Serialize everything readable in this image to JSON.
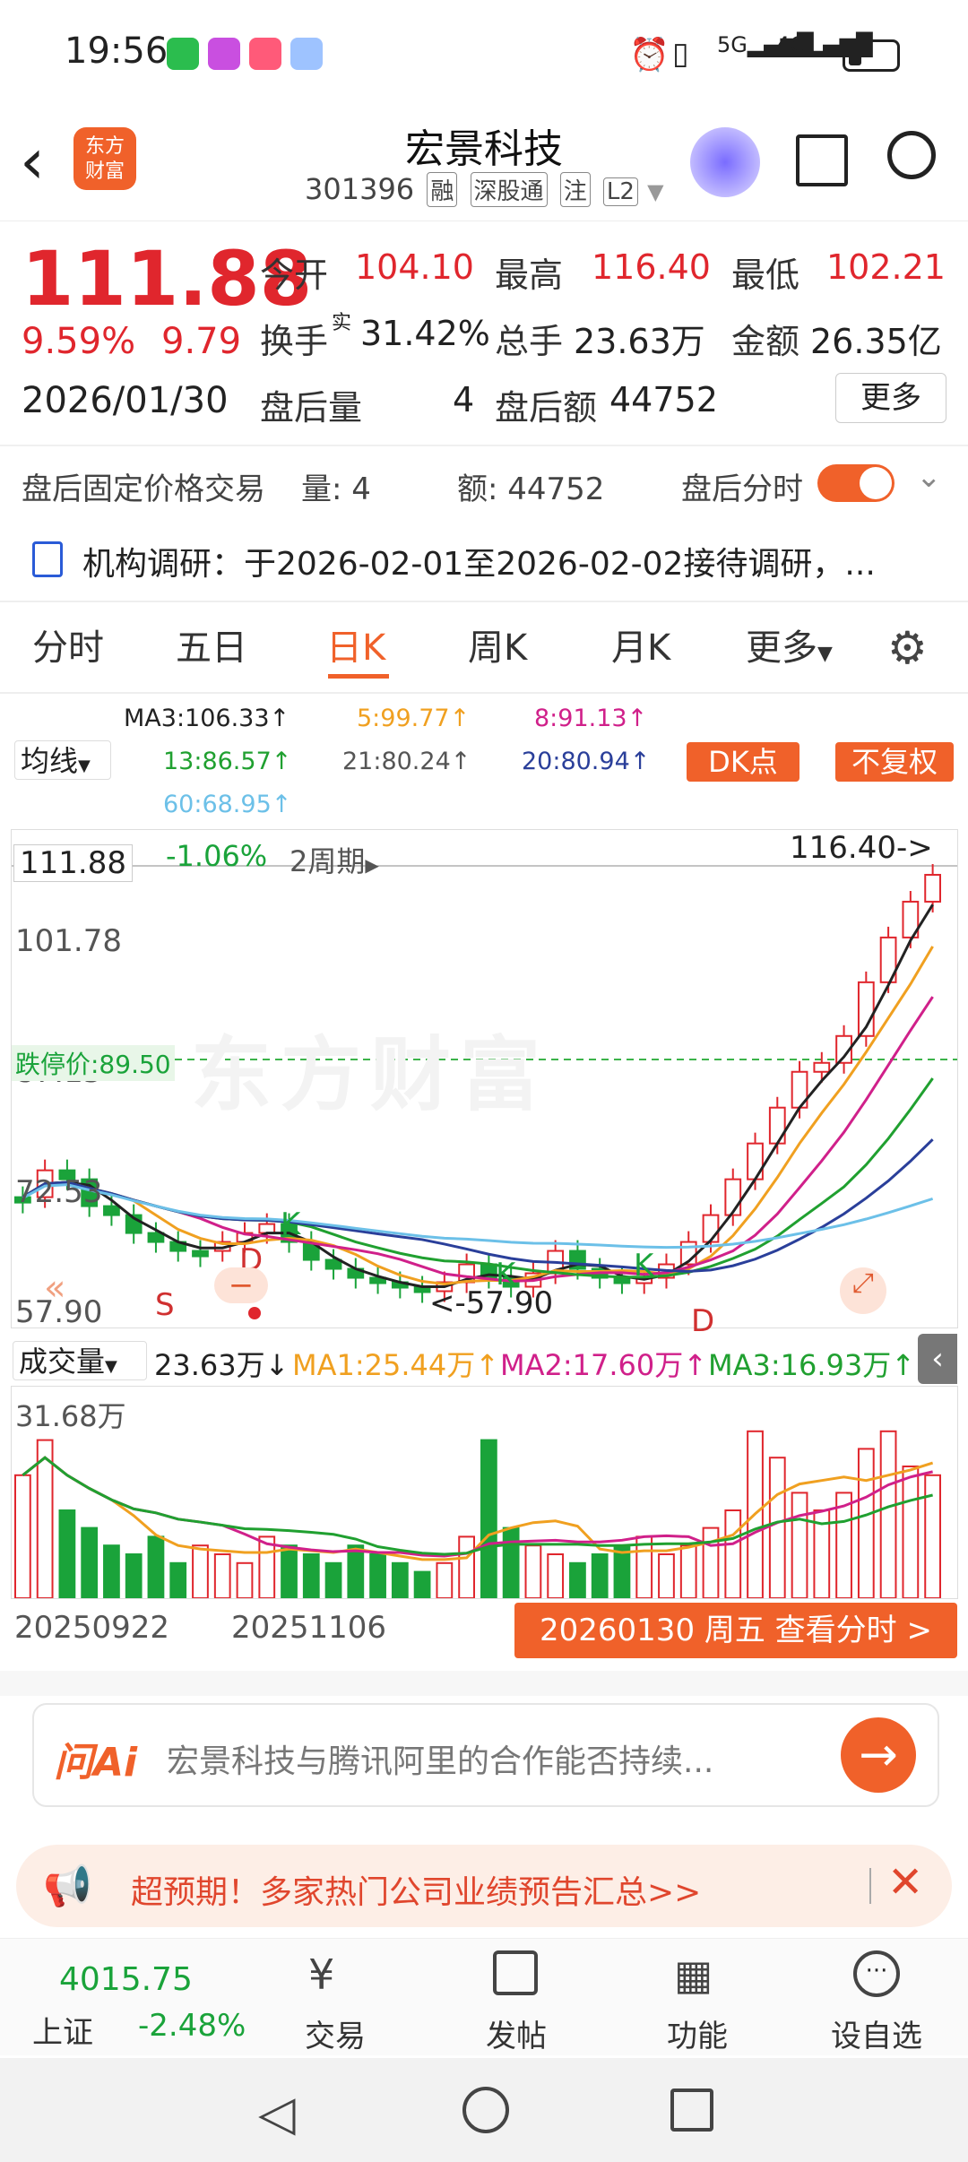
{
  "status_bar": {
    "time": "19:56",
    "icons": [
      "wechat-icon",
      "video-icon",
      "music-icon",
      "chat-bot-icon",
      "alarm-icon",
      "vibrate-icon",
      "signal-5g-icon",
      "signal-4g-icon",
      "battery-icon"
    ]
  },
  "header": {
    "title": "宏景科技",
    "code": "301396",
    "tags": [
      "融",
      "深股通",
      "注",
      "L2"
    ],
    "logo_text": "东方\n财富"
  },
  "quote": {
    "price": "111.88",
    "change_pct": "9.59%",
    "change": "9.79",
    "date": "2026/01/30",
    "open_label": "今开",
    "open": "104.10",
    "high_label": "最高",
    "high": "116.40",
    "low_label": "最低",
    "low": "102.21",
    "turnover_label": "换手",
    "turnover_sup": "实",
    "turnover": "31.42%",
    "volume_label": "总手",
    "volume": "23.63万",
    "amount_label": "金额",
    "amount": "26.35亿",
    "after_vol_label": "盘后量",
    "after_vol": "4",
    "after_amt_label": "盘后额",
    "after_amt": "44752",
    "more_button": "更多"
  },
  "after_hours": {
    "label": "盘后固定价格交易",
    "qty": "量: 4",
    "amt": "额: 44752",
    "toggle_label": "盘后分时"
  },
  "news": {
    "text": "机构调研：于2026-02-01至2026-02-02接待调研，..."
  },
  "tabs": [
    "分时",
    "五日",
    "日K",
    "周K",
    "月K",
    "更多"
  ],
  "active_tab": "日K",
  "ma_legend": {
    "selector": "均线",
    "ma3": "MA3:106.33↑",
    "ma5": "5:99.77↑",
    "ma8": "8:91.13↑",
    "ma13": "13:86.57↑",
    "ma21": "21:80.24↑",
    "ma20": "20:80.94↑",
    "ma60": "60:68.95↑",
    "dk_button": "DK点",
    "fq_button": "不复权"
  },
  "chart": {
    "current_price_tag": "111.88",
    "interval_pct": "-1.06%",
    "period": "2周期",
    "high_marker": "116.40->",
    "low_marker": "<-57.90",
    "limit_down": "跌停价:89.50",
    "y_labels": [
      "101.78",
      "87.15",
      "72.53",
      "57.90"
    ],
    "markers": [
      "S",
      "D",
      "K",
      "K",
      "K",
      "D"
    ]
  },
  "volume": {
    "selector": "成交量",
    "current": "23.63万↓",
    "ma1": "MA1:25.44万↑",
    "ma2": "MA2:17.60万↑",
    "ma3": "MA3:16.93万↑",
    "max_label": "31.68万",
    "date_start": "20250922",
    "date_mid": "20251106",
    "detail_button": "20260130 周五 查看分时 >"
  },
  "ai_bar": {
    "brand": "问Ai",
    "placeholder": "宏景科技与腾讯阿里的合作能否持续..."
  },
  "promo": {
    "text": "超预期！多家热门公司业绩预告汇总>>"
  },
  "bottom_nav": {
    "index_value": "4015.75",
    "index_name": "上证",
    "index_change": "-2.48%",
    "items": [
      "交易",
      "发帖",
      "功能",
      "设自选"
    ]
  },
  "colors": {
    "up": "#e0262d",
    "down": "#1aa33a",
    "accent": "#f0612a",
    "ma3": "#222222",
    "ma5": "#f0a020",
    "ma8": "#d0208a",
    "ma13": "#20a030",
    "ma20": "#2a3f9a",
    "ma60": "#6cc0e8"
  }
}
